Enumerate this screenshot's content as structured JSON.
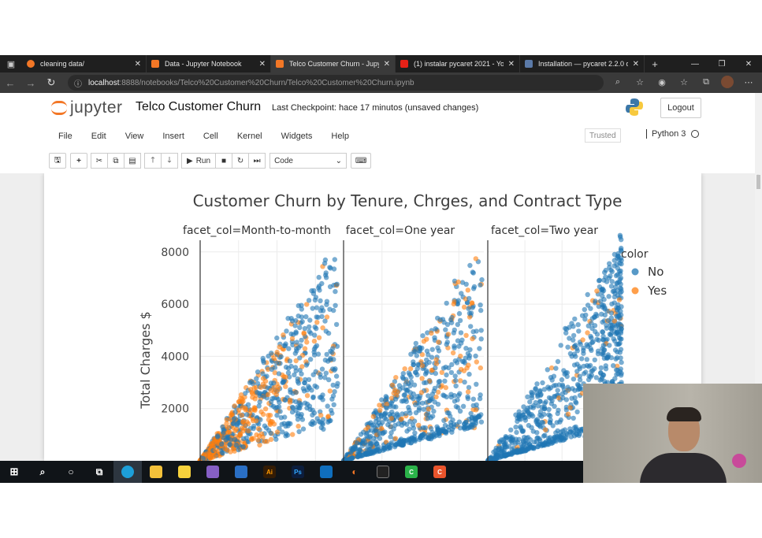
{
  "browser": {
    "tabs": [
      {
        "label": "cleaning data/",
        "fav_color": "#f37726"
      },
      {
        "label": "Data - Jupyter Notebook",
        "fav_color": "#f37726"
      },
      {
        "label": "Telco Customer Churn - Jupy",
        "fav_color": "#f37726",
        "active": true
      },
      {
        "label": "(1) instalar pycaret 2021 - Yo",
        "fav_color": "#e62117"
      },
      {
        "label": "Installation — pycaret 2.2.0 d",
        "fav_color": "#5b7aa8"
      }
    ],
    "new_tab": "+",
    "url_host": "localhost",
    "url_rest": ":8888/notebooks/Telco%20Customer%20Churn/Telco%20Customer%20Churn.ipynb"
  },
  "jupyter": {
    "logo_text": "jupyter",
    "notebook_title": "Telco Customer Churn",
    "checkpoint": "Last Checkpoint: hace 17 minutos  (unsaved changes)",
    "logout": "Logout",
    "menu": [
      "File",
      "Edit",
      "View",
      "Insert",
      "Cell",
      "Kernel",
      "Widgets",
      "Help"
    ],
    "trusted": "Trusted",
    "kernel_name": "Python 3",
    "run_label": "Run",
    "cell_type": "Code"
  },
  "chart_data": {
    "type": "scatter",
    "title": "Customer Churn by Tenure, Chrges, and Contract Type",
    "ylabel": "Total Charges $",
    "yticks": [
      "2000",
      "4000",
      "6000",
      "8000"
    ],
    "ylim": [
      0,
      9200
    ],
    "xlim": [
      0,
      73
    ],
    "facets": [
      "facet_col=Month-to-month",
      "facet_col=One year",
      "facet_col=Two year"
    ],
    "legend_title": "color",
    "legend": [
      {
        "name": "No",
        "color": "#1f77b4"
      },
      {
        "name": "Yes",
        "color": "#ff7f0e"
      }
    ]
  }
}
